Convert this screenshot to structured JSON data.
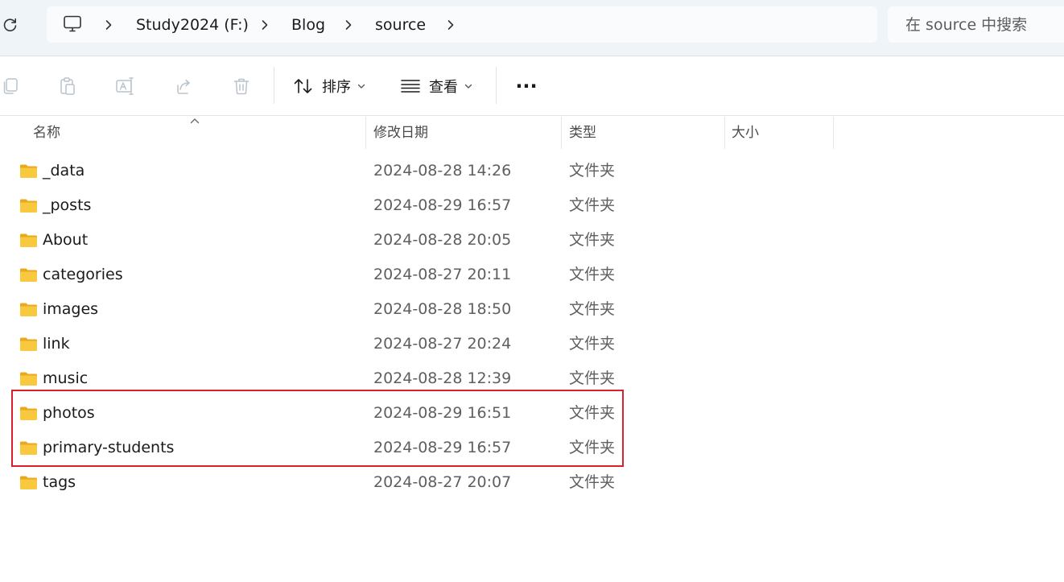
{
  "address_bar": {
    "breadcrumbs": [
      "Study2024 (F:)",
      "Blog",
      "source"
    ],
    "search_placeholder": "在 source 中搜索",
    "icons": {
      "refresh": "refresh-icon",
      "location": "this-pc-icon",
      "separator": "chevron-right-icon"
    }
  },
  "toolbar": {
    "icons": [
      "copy-icon",
      "paste-icon",
      "rename-icon",
      "share-icon",
      "delete-icon"
    ],
    "sort_label": "排序",
    "view_label": "查看",
    "more_label": "···"
  },
  "columns": {
    "name": "名称",
    "modified": "修改日期",
    "type": "类型",
    "size": "大小",
    "sorted_by": "name",
    "sort_direction": "ascending"
  },
  "files": [
    {
      "name": "_data",
      "modified": "2024-08-28 14:26",
      "type": "文件夹",
      "size": ""
    },
    {
      "name": "_posts",
      "modified": "2024-08-29 16:57",
      "type": "文件夹",
      "size": ""
    },
    {
      "name": "About",
      "modified": "2024-08-28 20:05",
      "type": "文件夹",
      "size": ""
    },
    {
      "name": "categories",
      "modified": "2024-08-27 20:11",
      "type": "文件夹",
      "size": ""
    },
    {
      "name": "images",
      "modified": "2024-08-28 18:50",
      "type": "文件夹",
      "size": ""
    },
    {
      "name": "link",
      "modified": "2024-08-27 20:24",
      "type": "文件夹",
      "size": ""
    },
    {
      "name": "music",
      "modified": "2024-08-28 12:39",
      "type": "文件夹",
      "size": ""
    },
    {
      "name": "photos",
      "modified": "2024-08-29 16:51",
      "type": "文件夹",
      "size": ""
    },
    {
      "name": "primary-students",
      "modified": "2024-08-29 16:57",
      "type": "文件夹",
      "size": ""
    },
    {
      "name": "tags",
      "modified": "2024-08-27 20:07",
      "type": "文件夹",
      "size": ""
    }
  ],
  "highlight": {
    "items": [
      "photos",
      "primary-students"
    ],
    "color": "#d9202d"
  },
  "colors": {
    "folder": "#f8c93f",
    "folder_dark": "#e8a91e",
    "chrome_bg": "#eff4f9",
    "icon_disabled": "#b9c3cc"
  }
}
